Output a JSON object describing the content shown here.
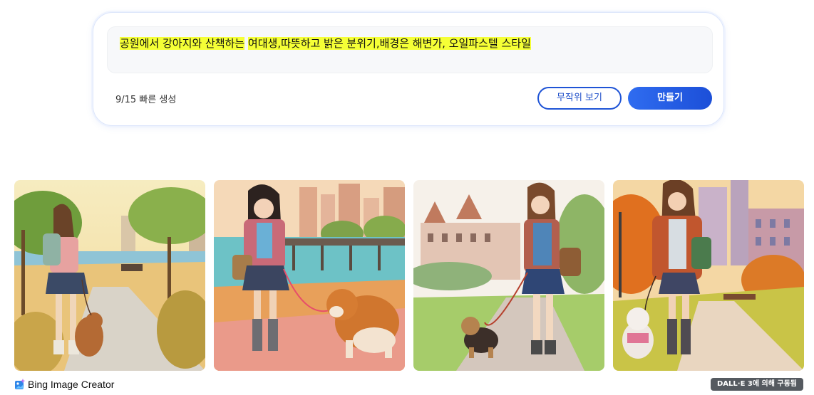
{
  "prompt": {
    "text_highlighted_1": "공원에서 강아지와 산책하는",
    "text_highlighted_2": "여대생,따뜻하고 밝은 분위기,배경은 해변가, 오일파스텔 스타일",
    "boost_count": "9/15 빠른 생성",
    "random_button_label": "무작위 보기",
    "create_button_label": "만들기"
  },
  "results": {
    "images": [
      {
        "scene": "girl-walking-away-with-poodle-seaside-park"
      },
      {
        "scene": "girl-walking-with-akita-by-pier"
      },
      {
        "scene": "girl-walking-yorkie-campus"
      },
      {
        "scene": "girl-walking-white-terrier-autumn-park"
      }
    ]
  },
  "footer": {
    "brand_label": "Bing Image Creator",
    "brand_icon": "image-creator-icon",
    "powered_by_label": "DALL·E 3에 의해 구동됨"
  },
  "colors": {
    "accent_blue": "#1f54d6",
    "highlight_yellow": "#f5ff36",
    "badge_gray": "#555a60"
  }
}
